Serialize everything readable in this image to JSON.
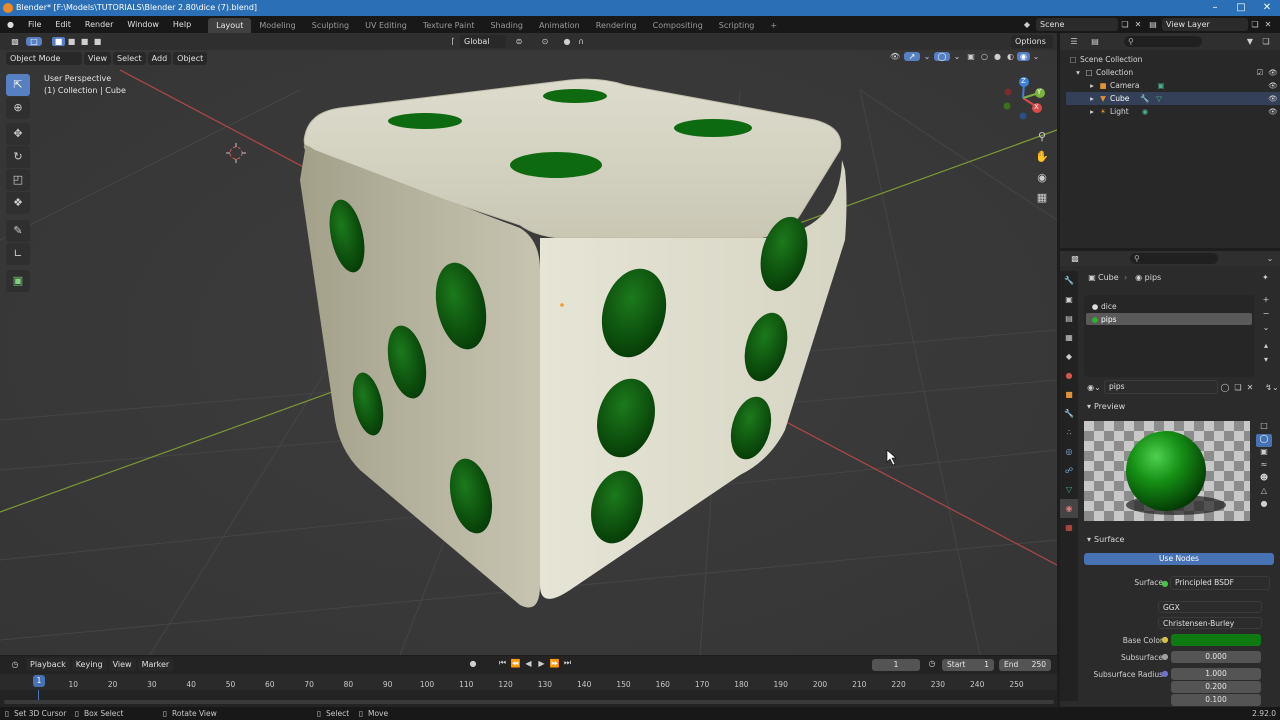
{
  "window": {
    "title": "Blender* [F:\\Models\\TUTORIALS\\Blender 2.80\\dice (7).blend]"
  },
  "menu": [
    "File",
    "Edit",
    "Render",
    "Window",
    "Help"
  ],
  "workspaces": [
    "Layout",
    "Modeling",
    "Sculpting",
    "UV Editing",
    "Texture Paint",
    "Shading",
    "Animation",
    "Rendering",
    "Compositing",
    "Scripting"
  ],
  "scene": {
    "name": "Scene",
    "view_layer": "View Layer"
  },
  "viewport": {
    "orientation": "Global",
    "options_label": "Options",
    "mode": "Object Mode",
    "menus": [
      "View",
      "Select",
      "Add",
      "Object"
    ],
    "overlay_title": "User Perspective",
    "overlay_sub": "(1) Collection | Cube",
    "gizmo": {
      "x": "X",
      "y": "Y",
      "z": "Z"
    }
  },
  "outliner": {
    "scene_collection": "Scene Collection",
    "collection": "Collection",
    "items": [
      "Camera",
      "Cube",
      "Light"
    ]
  },
  "properties": {
    "breadcrumb_object": "Cube",
    "breadcrumb_material": "pips",
    "slots": [
      "dice",
      "pips"
    ],
    "material_name": "pips",
    "preview_label": "Preview",
    "surface_label": "Surface",
    "use_nodes": "Use Nodes",
    "surface_field_label": "Surface",
    "surface_value": "Principled BSDF",
    "distribution": "GGX",
    "subsurface_method": "Christensen-Burley",
    "base_color_label": "Base Color",
    "base_color": "#0f7a0f",
    "subsurface_label": "Subsurface",
    "subsurface_value": "0.000",
    "subsurface_radius_label": "Subsurface Radius",
    "subsurface_radius": [
      "1.000",
      "0.200",
      "0.100"
    ]
  },
  "timeline": {
    "menus": [
      "Playback",
      "Keying",
      "View",
      "Marker"
    ],
    "current_frame": "1",
    "start_label": "Start",
    "start": "1",
    "end_label": "End",
    "end": "250",
    "ticks": [
      "10",
      "20",
      "30",
      "40",
      "50",
      "60",
      "70",
      "80",
      "90",
      "100",
      "110",
      "120",
      "130",
      "140",
      "150",
      "160",
      "170",
      "180",
      "190",
      "200",
      "210",
      "220",
      "230",
      "240",
      "250"
    ],
    "playhead": "1"
  },
  "statusbar": {
    "items": [
      "Set 3D Cursor",
      "Box Select",
      "Rotate View",
      "Select",
      "Move"
    ],
    "version": "2.92.0"
  },
  "colors": {
    "pip_green": "#0e5a10",
    "dice_body": "#d9d8c6",
    "accent_blue": "#4772b3"
  }
}
